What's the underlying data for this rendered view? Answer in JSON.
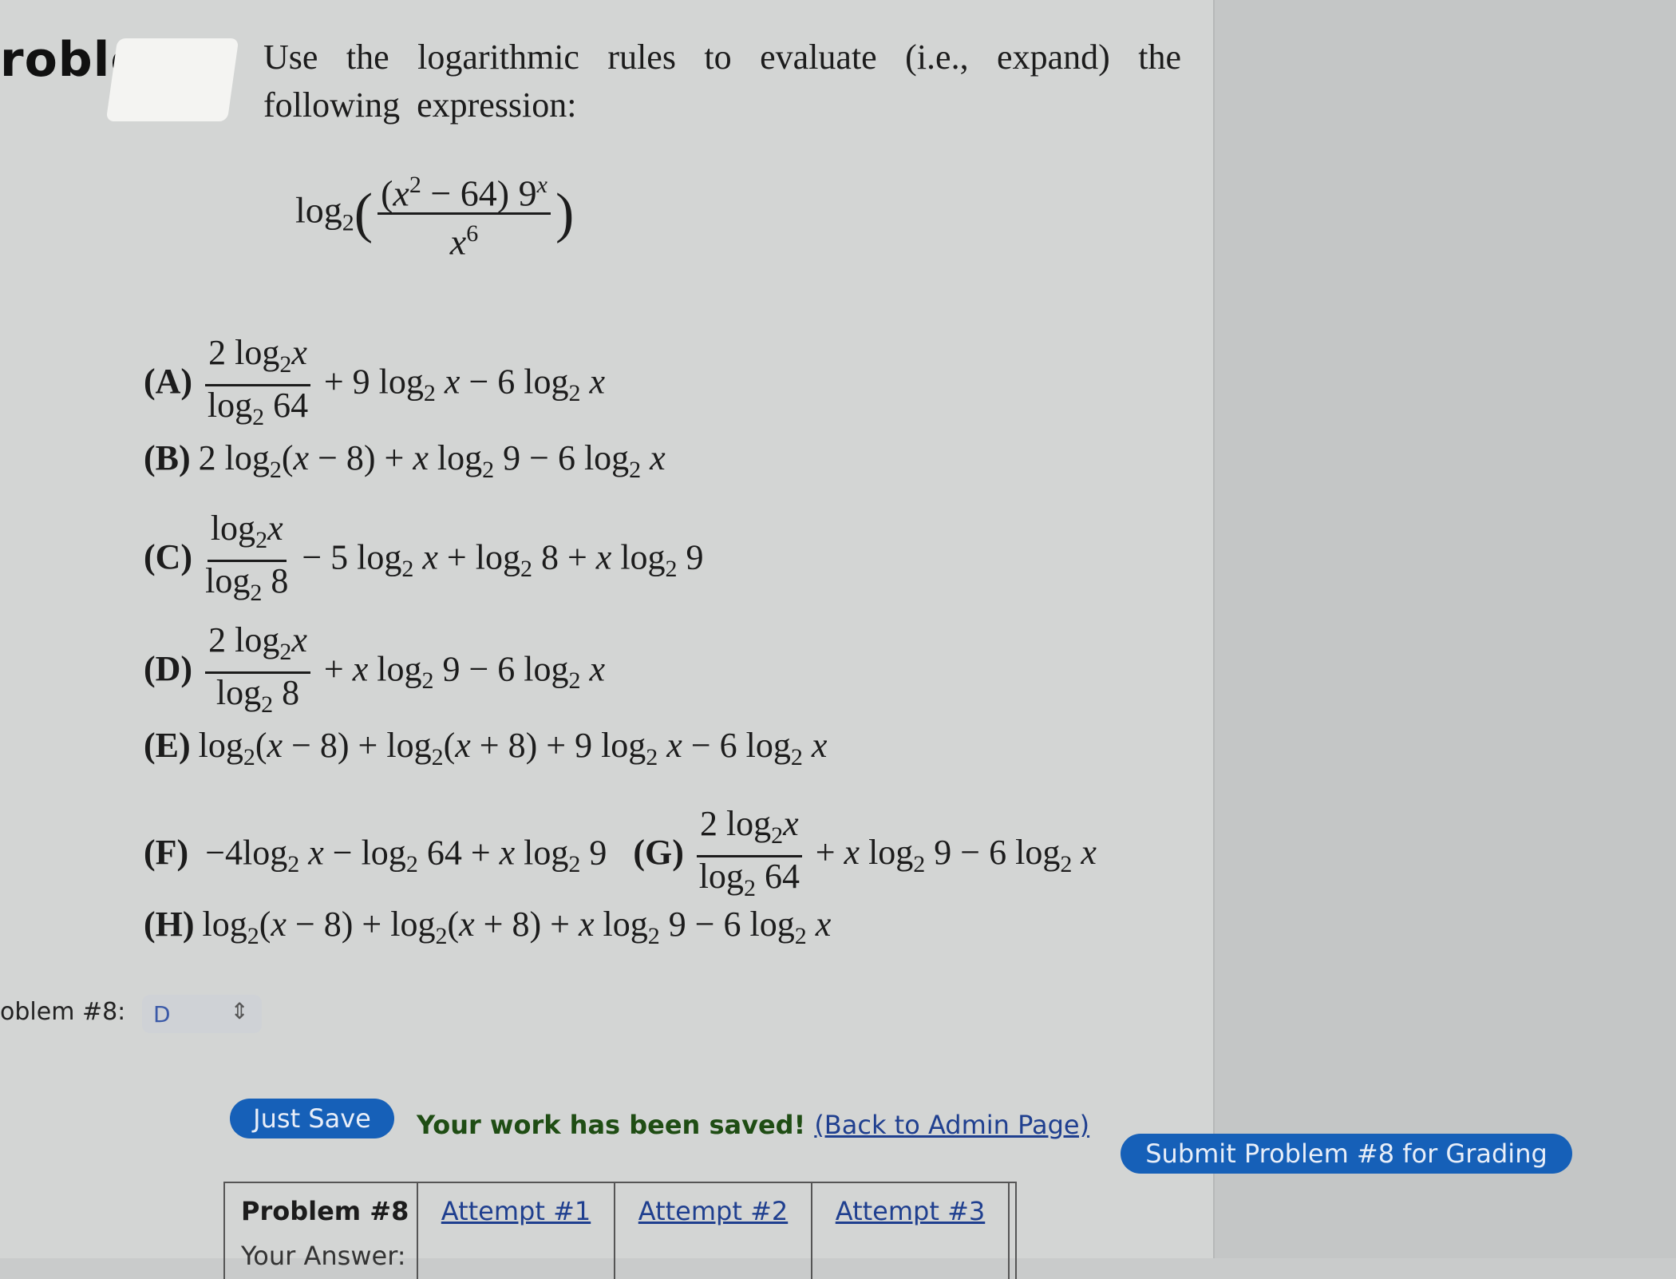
{
  "header": {
    "problem_label": "roblem"
  },
  "prompt": {
    "text": "Use the logarithmic rules to evaluate (i.e., expand) the following expression:"
  },
  "expression": {
    "log": "log",
    "base": "2",
    "numerator_a": "(",
    "x": "x",
    "exp2": "2",
    "minus64": " − 64) 9",
    "expx": "x",
    "denominator": "x",
    "den_exp": "6"
  },
  "options": {
    "A": {
      "label": "(A)"
    },
    "B": {
      "label": "(B)"
    },
    "C": {
      "label": "(C)"
    },
    "D": {
      "label": "(D)"
    },
    "E": {
      "label": "(E)"
    },
    "F": {
      "label": "(F)"
    },
    "G": {
      "label": "(G)"
    },
    "H": {
      "label": "(H)"
    }
  },
  "answer": {
    "row_label": "oblem #8:",
    "selected": "D",
    "chevron_icon": "updown-chevron-icon"
  },
  "actions": {
    "just_save": "Just Save",
    "saved_message": "Your work has been saved!",
    "back_link": "(Back to Admin Page)",
    "submit": "Submit Problem #8 for Grading"
  },
  "attempts_table": {
    "header": "Problem #8",
    "row_label": "Your Answer:",
    "attempts": [
      "Attempt #1",
      "Attempt #2",
      "Attempt #3"
    ]
  },
  "colors": {
    "accent": "#1660b8",
    "saved_text": "#1f4d14",
    "link": "#1f3f8f"
  }
}
